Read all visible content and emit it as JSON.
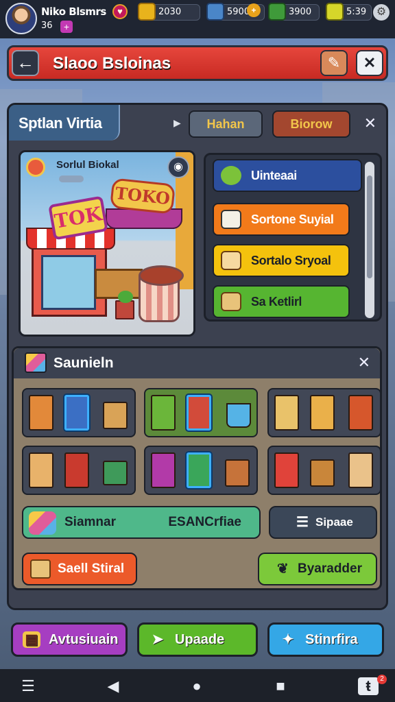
{
  "hud": {
    "player_name": "Niko Blsmrs",
    "player_level": "36",
    "resources": [
      {
        "name": "gold",
        "value": "2030",
        "icon": "gold-bar-icon",
        "color": "#e8b31c"
      },
      {
        "name": "tickets",
        "value": "5900",
        "icon": "ticket-icon",
        "color": "#4a86c8"
      },
      {
        "name": "cash",
        "value": "3900",
        "icon": "cash-icon",
        "color": "#3f9a3a"
      },
      {
        "name": "energy",
        "value": "5:39",
        "icon": "battery-icon",
        "color": "#d6d62a"
      }
    ]
  },
  "title": "Slaoo Bsloinas",
  "panel": {
    "header": "Sptlan Virtia",
    "tabs": [
      "Hahan",
      "Biorow"
    ]
  },
  "shop_art": {
    "name": "Sorlul Biokal",
    "sign1": "TOK",
    "sign2": "TOKO"
  },
  "categories": [
    {
      "label": "Uinteaai",
      "icon": "check-icon",
      "color": "#2c4f9e",
      "text_color": "#ffffff"
    },
    {
      "label": "Sortone Suyial",
      "icon": "stack-icon",
      "color": "#f27a1a",
      "text_color": "#ffffff"
    },
    {
      "label": "Sortalo Sryoal",
      "icon": "crate-icon",
      "color": "#f4c20d",
      "text_color": "#1a1f29"
    },
    {
      "label": "Sa Ketlirl",
      "icon": "parcel-icon",
      "color": "#56b531",
      "text_color": "#1a1f29"
    }
  ],
  "inventory": {
    "title": "Saunieln",
    "wide_left": "Siamnar",
    "wide_right": "ESANCrfiae",
    "side_button": "Sipaae",
    "sell_button": "Saell Stiral",
    "upgrade_button": "Byaradder"
  },
  "bottom": [
    {
      "label": "Avtusiuain",
      "color": "#a63ec1",
      "icon": "card-icon"
    },
    {
      "label": "Upaade",
      "color": "#5cb82a",
      "icon": "upgrade-icon"
    },
    {
      "label": "Stinrfira",
      "color": "#34a7e6",
      "icon": "share-icon"
    }
  ],
  "nav_badge": "2"
}
